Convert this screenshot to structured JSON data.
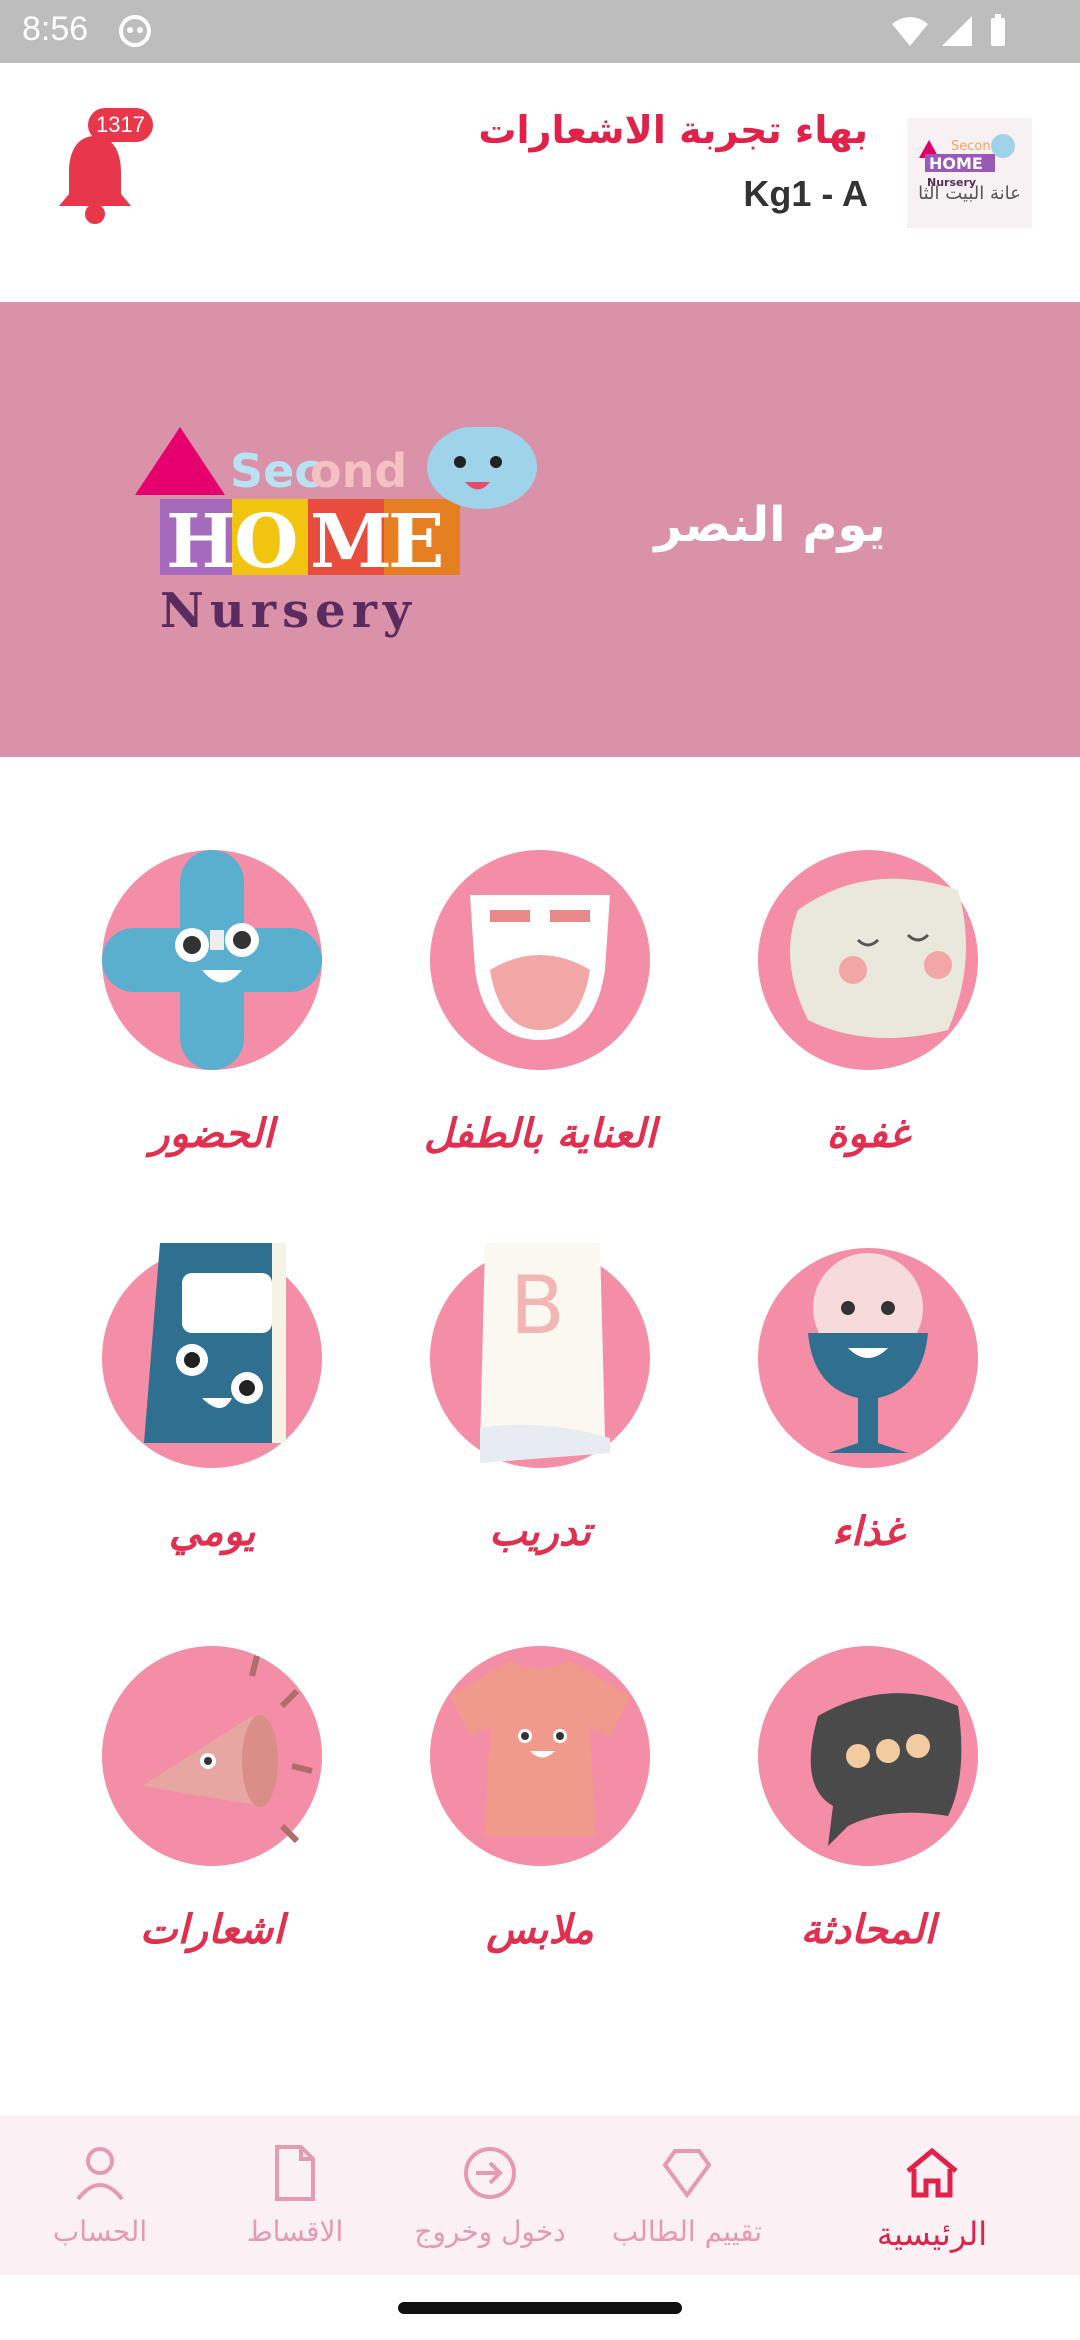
{
  "status_bar": {
    "time": "8:56"
  },
  "header": {
    "user_name": "بهاء تجربة الاشعارات",
    "class_name": "Kg1 - A",
    "notification_count": "1317",
    "logo_caption": "عانة البيت الثا"
  },
  "banner": {
    "title": "يوم النصر"
  },
  "tiles": [
    {
      "label": "غفوة",
      "icon": "nap-pillow-icon"
    },
    {
      "label": "العناية بالطفل",
      "icon": "diaper-icon"
    },
    {
      "label": "الحضور",
      "icon": "attendance-cross-icon"
    },
    {
      "label": "غذاء",
      "icon": "food-cup-icon"
    },
    {
      "label": "تدريب",
      "icon": "training-paper-icon"
    },
    {
      "label": "يومي",
      "icon": "daily-book-icon"
    },
    {
      "label": "المحادثة",
      "icon": "chat-bubble-icon"
    },
    {
      "label": "ملابس",
      "icon": "clothes-shirt-icon"
    },
    {
      "label": "اشعارات",
      "icon": "megaphone-icon"
    }
  ],
  "bottom_nav": [
    {
      "label": "الرئيسية",
      "icon": "home-icon",
      "active": true
    },
    {
      "label": "تقييم الطالب",
      "icon": "diamond-icon",
      "active": false
    },
    {
      "label": "دخول وخروج",
      "icon": "sign-in-icon",
      "active": false
    },
    {
      "label": "الاقساط",
      "icon": "document-icon",
      "active": false
    },
    {
      "label": "الحساب",
      "icon": "person-icon",
      "active": false
    }
  ],
  "colors": {
    "accent": "#e0224a",
    "banner": "#d992a8",
    "circle": "#f48ea6",
    "nav_bg": "#fbf0f4",
    "nav_inactive": "#e59ab0"
  }
}
